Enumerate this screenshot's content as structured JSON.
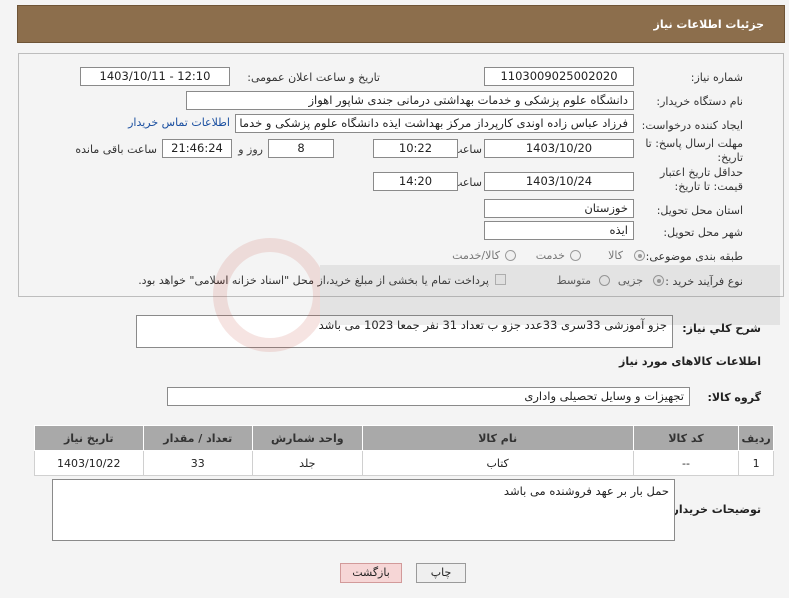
{
  "header": {
    "title": "جزئیات اطلاعات نیاز"
  },
  "labels": {
    "need_number": "شماره نیاز:",
    "announce_datetime": "تاریخ و ساعت اعلان عمومی:",
    "buyer_org": "نام دستگاه خریدار:",
    "requester": "ایجاد کننده درخواست:",
    "deadline": "مهلت ارسال پاسخ: تا تاریخ:",
    "time": "ساعت",
    "day_and": "روز و",
    "remaining": "ساعت باقی مانده",
    "min_price_validity": "حداقل تاریخ اعتبار قیمت: تا تاریخ:",
    "province": "استان محل تحویل:",
    "city": "شهر محل تحویل:",
    "category": "طبقه بندی موضوعی:",
    "process_type": "نوع فرآیند خرید :",
    "need_summary": "شرح کلي نياز:",
    "goods_info": "اطلاعات کالاهای مورد نیاز",
    "goods_group": "گروه کالا:",
    "buyer_notes": "توضیحات خریدار:"
  },
  "fields": {
    "need_number": "1103009025002020",
    "announce_datetime": "1403/10/11 - 12:10",
    "buyer_org": "دانشگاه علوم پزشکی و خدمات بهداشتی درمانی جندی شاپور اهواز",
    "requester": "فرزاد عباس زاده اوندی کارپرداز مرکز بهداشت ایذه دانشگاه علوم پزشکی و خدما",
    "contact_link": "اطلاعات تماس خریدار",
    "deadline_date": "1403/10/20",
    "deadline_time": "10:22",
    "days": "8",
    "remaining_time": "21:46:24",
    "validity_date": "1403/10/24",
    "validity_time": "14:20",
    "province": "خوزستان",
    "city": "ایذه",
    "need_summary": "جزو آموزشی 33سری 33عدد جزو ب تعداد 31 نفر جمعا 1023 می باشد",
    "goods_group": "تجهیزات و وسایل تحصیلی واداری",
    "buyer_notes": "حمل بار بر عهد فروشنده می باشد"
  },
  "category_options": [
    "کالا",
    "خدمت",
    "کالا/خدمت"
  ],
  "category_selected": "کالا",
  "process_options": [
    "جزیی",
    "متوسط"
  ],
  "process_selected": "جزیی",
  "payment_note": "پرداخت تمام یا بخشی از مبلغ خرید،از محل \"اسناد خزانه اسلامی\" خواهد بود.",
  "table": {
    "headers": [
      "ردیف",
      "کد کالا",
      "نام کالا",
      "واحد شمارش",
      "تعداد / مقدار",
      "تاریخ نیاز"
    ],
    "rows": [
      [
        "1",
        "--",
        "کتاب",
        "جلد",
        "33",
        "1403/10/22"
      ]
    ]
  },
  "buttons": {
    "print": "چاپ",
    "back": "بازگشت"
  },
  "colors": {
    "header_bg": "#8c6e4c",
    "link": "#1a4fa0",
    "back_button_bg": "#f6d6d6"
  }
}
